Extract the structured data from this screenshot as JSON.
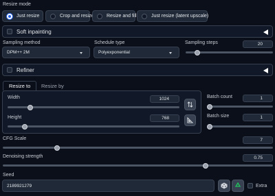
{
  "resize_mode": {
    "label": "Resize mode",
    "options": [
      "Just resize",
      "Crop and resize",
      "Resize and fill",
      "Just resize (latent upscale)"
    ],
    "selected": "Just resize"
  },
  "soft_inpainting": {
    "title": "Soft inpainting",
    "checked": false
  },
  "sampling_method": {
    "label": "Sampling method",
    "value": "DPM++ 2M"
  },
  "schedule_type": {
    "label": "Schedule type",
    "value": "Polyexponential"
  },
  "sampling_steps": {
    "label": "Sampling steps",
    "value": "20",
    "fraction": 0.13
  },
  "refiner": {
    "title": "Refiner",
    "checked": false
  },
  "tabs": {
    "resize_to": "Resize to",
    "resize_by": "Resize by",
    "active": "Resize to"
  },
  "width": {
    "label": "Width",
    "value": "1024",
    "fraction": 0.13
  },
  "height": {
    "label": "Height",
    "value": "768",
    "fraction": 0.1
  },
  "swap_icon": "swap-vertical-icon",
  "ratio_icon": "triangle-ruler-icon",
  "batch_count": {
    "label": "Batch count",
    "value": "1",
    "fraction": 0.0
  },
  "batch_size": {
    "label": "Batch size",
    "value": "1",
    "fraction": 0.0
  },
  "cfg_scale": {
    "label": "CFG Scale",
    "value": "7",
    "fraction": 0.2
  },
  "denoising": {
    "label": "Denoising strength",
    "value": "0.75",
    "fraction": 0.75
  },
  "seed": {
    "label": "Seed",
    "value": "2189921279",
    "extra_label": "Extra"
  },
  "colors": {
    "accent": "#2563eb",
    "background": "#0b0f19",
    "panel": "#111827"
  }
}
